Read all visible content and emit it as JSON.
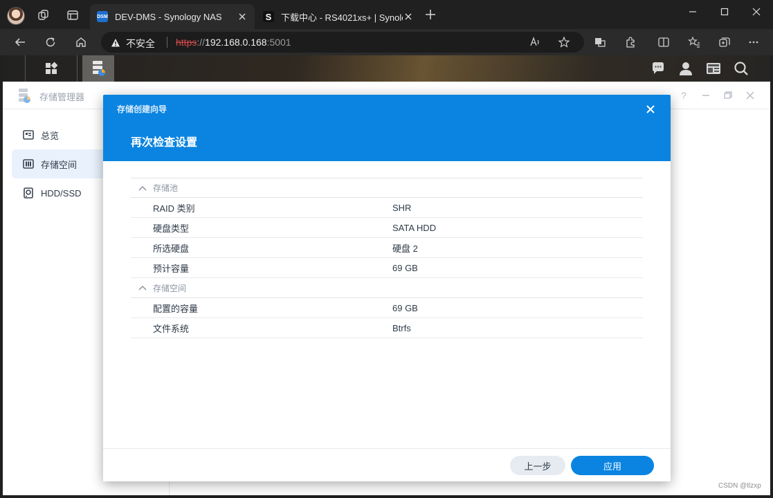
{
  "browser": {
    "tabs": [
      {
        "title": "DEV-DMS - Synology NAS",
        "favicon": "DSM",
        "active": true
      },
      {
        "title": "下载中心 - RS4021xs+ | Synology",
        "favicon": "S",
        "active": false
      }
    ],
    "address": {
      "security_label": "不安全",
      "scheme": "https",
      "separator": "://",
      "host": "192.168.0.168",
      "port": ":5001"
    }
  },
  "storage_manager": {
    "title": "存储管理器",
    "sidebar": [
      {
        "label": "总览",
        "icon": "overview-icon",
        "selected": false
      },
      {
        "label": "存储空间",
        "icon": "volume-icon",
        "selected": true
      },
      {
        "label": "HDD/SSD",
        "icon": "disk-icon",
        "selected": false
      }
    ]
  },
  "wizard": {
    "title": "存储创建向导",
    "subtitle": "再次检查设置",
    "sections": [
      {
        "header": "存储池",
        "rows": [
          {
            "key": "RAID 类别",
            "value": "SHR"
          },
          {
            "key": "硬盘类型",
            "value": "SATA HDD"
          },
          {
            "key": "所选硬盘",
            "value": "硬盘 2"
          },
          {
            "key": "预计容量",
            "value": "69 GB"
          }
        ]
      },
      {
        "header": "存储空间",
        "rows": [
          {
            "key": "配置的容量",
            "value": "69 GB"
          },
          {
            "key": "文件系统",
            "value": "Btrfs"
          }
        ]
      }
    ],
    "buttons": {
      "prev": "上一步",
      "apply": "应用"
    }
  },
  "watermark": "CSDN @tlzxp",
  "colors": {
    "accent": "#0a84e0",
    "selected_bg": "#e8f1fc"
  }
}
